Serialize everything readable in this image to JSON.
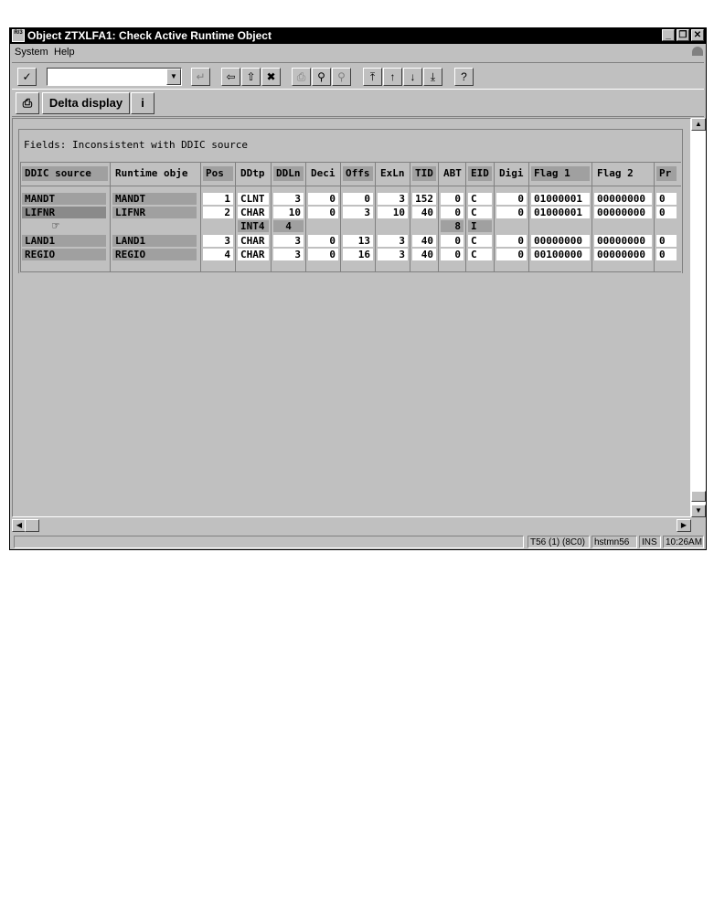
{
  "window": {
    "title": "Object ZTXLFA1:  Check Active Runtime Object",
    "icon_label": "R/3",
    "buttons": [
      "minimize-icon",
      "restore-icon",
      "close-icon"
    ]
  },
  "menu": {
    "items": [
      {
        "label": "System"
      },
      {
        "label": "Help"
      }
    ]
  },
  "toolbar": {
    "command_field": "",
    "icons": [
      "check-icon",
      "dropdown-icon",
      "enter-icon",
      "back-icon",
      "exit-icon",
      "cancel-icon",
      "print-icon",
      "find-icon",
      "find-next-icon",
      "first-page-icon",
      "previous-page-icon",
      "next-page-icon",
      "last-page-icon",
      "help-icon"
    ]
  },
  "app_toolbar": {
    "print_icon": "print-icon",
    "delta_label": "Delta display",
    "info_icon": "info-icon"
  },
  "frame": {
    "title": "Fields: Inconsistent with DDIC source"
  },
  "table": {
    "headers": [
      "DDIC source",
      "Runtime obje",
      "Pos",
      "DDtp",
      "DDLn",
      "Deci",
      "Offs",
      "ExLn",
      "TID",
      "ABT",
      "EID",
      "Digi",
      "Flag 1",
      "Flag 2",
      "Pr"
    ],
    "rows": [
      {
        "ddic": "MANDT",
        "runtime": "MANDT",
        "pos": "1",
        "ddtp": "CLNT",
        "ddln": "3",
        "deci": "0",
        "offs": "0",
        "exln": "3",
        "tid": "152",
        "abt": "0",
        "eid": "C",
        "digi": "0",
        "flag1": "01000001",
        "flag2": "00000000",
        "pr": "0"
      },
      {
        "ddic": "LIFNR",
        "runtime": "LIFNR",
        "pos": "2",
        "ddtp": "CHAR",
        "ddln": "10",
        "deci": "0",
        "offs": "3",
        "exln": "10",
        "tid": "40",
        "abt": "0",
        "eid": "C",
        "digi": "0",
        "flag1": "01000001",
        "flag2": "00000000",
        "pr": "0"
      },
      {
        "ddic": "",
        "runtime": "",
        "pos": "",
        "ddtp": "INT4",
        "ddln": "4",
        "deci": "",
        "offs": "",
        "exln": "",
        "tid": "",
        "abt": "8",
        "eid": "I",
        "digi": "",
        "flag1": "",
        "flag2": "",
        "pr": ""
      },
      {
        "ddic": "LAND1",
        "runtime": "LAND1",
        "pos": "3",
        "ddtp": "CHAR",
        "ddln": "3",
        "deci": "0",
        "offs": "13",
        "exln": "3",
        "tid": "40",
        "abt": "0",
        "eid": "C",
        "digi": "0",
        "flag1": "00000000",
        "flag2": "00000000",
        "pr": "0"
      },
      {
        "ddic": "REGIO",
        "runtime": "REGIO",
        "pos": "4",
        "ddtp": "CHAR",
        "ddln": "3",
        "deci": "0",
        "offs": "16",
        "exln": "3",
        "tid": "40",
        "abt": "0",
        "eid": "C",
        "digi": "0",
        "flag1": "00100000",
        "flag2": "00000000",
        "pr": "0"
      }
    ]
  },
  "statusbar": {
    "message": "",
    "system": "T56 (1) (8C0)",
    "server": "hstmn56",
    "mode": "INS",
    "time": "10:26AM"
  }
}
